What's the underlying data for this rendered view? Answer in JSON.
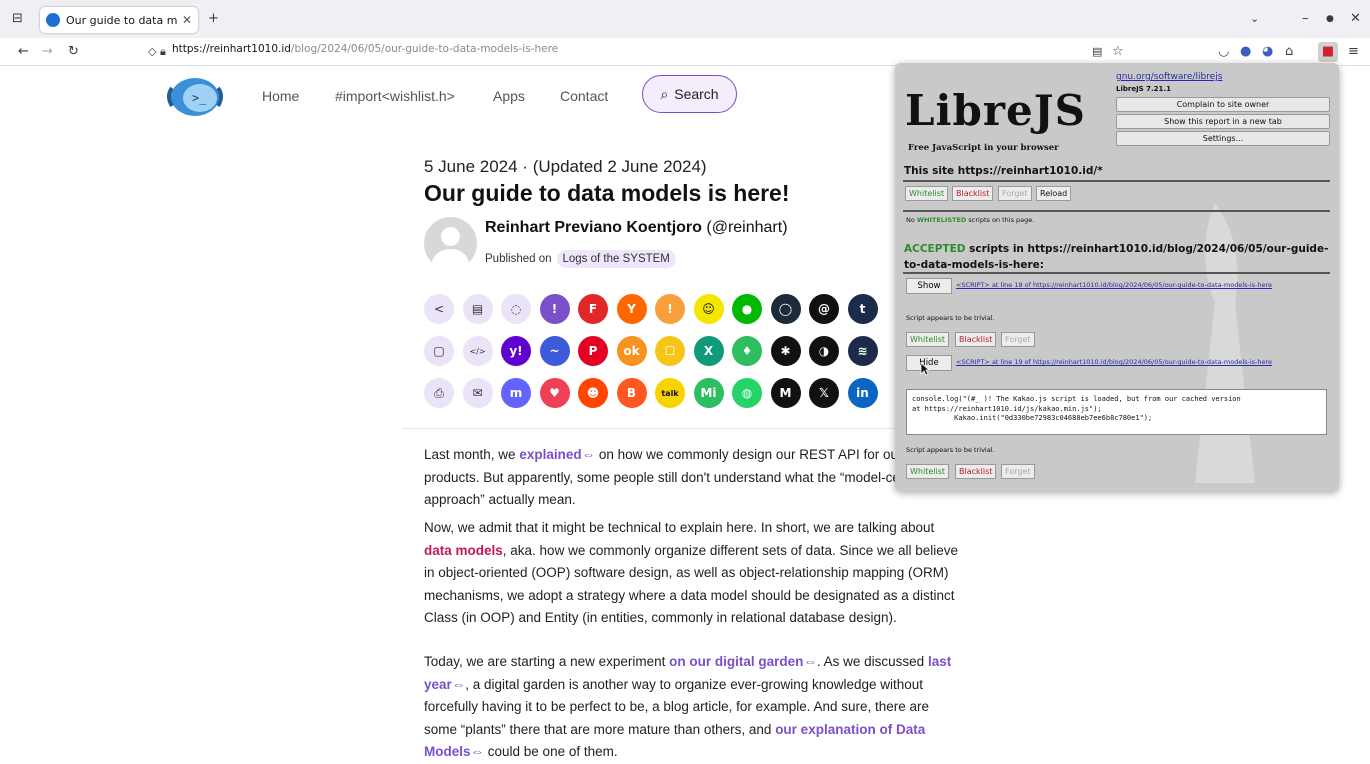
{
  "browser": {
    "tab_title": "Our guide to data models",
    "url_host": "https://reinhart1010.id",
    "url_path": "/blog/2024/06/05/our-guide-to-data-models-is-here"
  },
  "site_nav": {
    "items": [
      "Home",
      "#import<wishlist.h>",
      "Apps",
      "Contact"
    ],
    "search": "Search"
  },
  "article": {
    "date": "5 June 2024 · (Updated 2 June 2024)",
    "title": "Our guide to data models is here!",
    "author_name": "Reinhart Previano Koentjoro",
    "author_handle": "(@reinhart)",
    "published_on": "Published on",
    "category": "Logs of the SYSTEM",
    "p1_a": "Last month, we ",
    "p1_link": "explained",
    "p1_b": " on how we commonly design our REST API for our products. But apparently, some people still don't understand what the “model-centric path approach” actually mean.",
    "p2_a": "Now, we admit that it might be technical to explain here. In short, we are talking about ",
    "p2_link": "data models",
    "p2_b": ", aka. how we commonly organize different sets of data. Since we all believe in object-oriented (OOP) software design, as well as object-relationship mapping (ORM) mechanisms, we adopt a strategy where a data model should be designated as a distinct Class (in OOP) and Entity (in entities, commonly in relational database design).",
    "p3_a": "Today, we are starting a new experiment ",
    "p3_link1": "on our digital garden",
    "p3_b": ". As we discussed ",
    "p3_link2": "last year",
    "p3_c": ", a digital garden is another way to organize ever-growing knowledge without forcefully having it to be perfect to be, a blog article, for example. And sure, there are some “plants” there that are more mature than others, and ",
    "p3_link3": "our explanation of Data Models",
    "p3_d": " could be one of them."
  },
  "share_icons": [
    [
      {
        "name": "share",
        "color": "#ebe3f8",
        "g": "<"
      },
      {
        "name": "print-pdf",
        "color": "#ebe3f8",
        "g": "▤"
      },
      {
        "name": "comment",
        "color": "#ebe3f8",
        "g": "◌"
      },
      {
        "name": "kakao-story",
        "color": "#7b4fc8",
        "g": "!"
      },
      {
        "name": "flipboard",
        "color": "#e12828",
        "g": "F"
      },
      {
        "name": "hacker-news",
        "color": "#ff6600",
        "g": "Y"
      },
      {
        "name": "kakao",
        "color": "#f9a03c",
        "g": "!"
      },
      {
        "name": "snapchat",
        "color": "#f5e600",
        "g": "☺"
      },
      {
        "name": "line",
        "color": "#00b900",
        "g": "●"
      },
      {
        "name": "signal",
        "color": "#1c2a3a",
        "g": "◯"
      },
      {
        "name": "threads",
        "color": "#111111",
        "g": "@"
      },
      {
        "name": "tumblr",
        "color": "#1c2b4a",
        "g": "t"
      }
    ],
    [
      {
        "name": "copy",
        "color": "#ebe3f8",
        "g": "▢"
      },
      {
        "name": "embed",
        "color": "#ebe3f8",
        "g": "</>"
      },
      {
        "name": "yahoo",
        "color": "#5f01d1",
        "g": "y!"
      },
      {
        "name": "messenger",
        "color": "#3b5bdb",
        "g": "~"
      },
      {
        "name": "pinterest",
        "color": "#e60023",
        "g": "P"
      },
      {
        "name": "odnoklassniki",
        "color": "#f7931e",
        "g": "ok"
      },
      {
        "name": "qzone",
        "color": "#f5c518",
        "g": "☐"
      },
      {
        "name": "xing",
        "color": "#0f9b7a",
        "g": "X"
      },
      {
        "name": "evernote",
        "color": "#2dbe60",
        "g": "♦"
      },
      {
        "name": "asterisk",
        "color": "#111111",
        "g": "✱"
      },
      {
        "name": "wechat-mini",
        "color": "#111111",
        "g": "◑"
      },
      {
        "name": "buffer",
        "color": "#1c2b4a",
        "g": "≋"
      }
    ],
    [
      {
        "name": "print",
        "color": "#ebe3f8",
        "g": "⎙"
      },
      {
        "name": "email",
        "color": "#ebe3f8",
        "g": "✉"
      },
      {
        "name": "mastodon",
        "color": "#6364ff",
        "g": "m"
      },
      {
        "name": "pocket",
        "color": "#ef4056",
        "g": "♥"
      },
      {
        "name": "reddit",
        "color": "#ff4500",
        "g": "☻"
      },
      {
        "name": "blogger",
        "color": "#ff5722",
        "g": "B"
      },
      {
        "name": "kakao-talk",
        "color": "#f7d400",
        "g": "talk"
      },
      {
        "name": "mix",
        "color": "#2dbe60",
        "g": "Mi"
      },
      {
        "name": "whatsapp",
        "color": "#25d366",
        "g": "◍"
      },
      {
        "name": "gmail",
        "color": "#111111",
        "g": "M"
      },
      {
        "name": "x",
        "color": "#111111",
        "g": "𝕏"
      },
      {
        "name": "linkedin",
        "color": "#0a66c2",
        "g": "in"
      }
    ]
  ],
  "librejs": {
    "logo": "LibreJS",
    "tagline": "Free JavaScript in your browser",
    "link": "gnu.org/software/librejs",
    "version": "LibreJS 7.21.1",
    "btn_complain": "Complain to site owner",
    "btn_report": "Show this report in a new tab",
    "btn_settings": "Settings...",
    "site_heading": "This site https://reinhart1010.id/*",
    "whitelist": "Whitelist",
    "blacklist": "Blacklist",
    "forget": "Forget",
    "reload": "Reload",
    "no_whitelisted_pre": "No ",
    "no_whitelisted_kw": "WHITELISTED",
    "no_whitelisted_post": " scripts on this page.",
    "accepted_kw": "ACCEPTED",
    "accepted_rest": " scripts in https://reinhart1010.id/blog/2024/06/05/our-guide-to-data-models-is-here:",
    "show": "Show",
    "hide": "Hide",
    "script1": "<SCRIPT> at line 18 of https://reinhart1010.id/blog/2024/06/05/our-guide-to-data-models-is-here",
    "script2": "<SCRIPT> at line 19 of https://reinhart1010.id/blog/2024/06/05/our-guide-to-data-models-is-here",
    "trivial": "Script appears to be trivial.",
    "code": "console.log(\"(#_ )! The Kakao.js script is loaded, but from our cached version\nat https://reinhart1010.id/js/kakao.min.js\");\n          Kakao.init(\"0d330be72983c04688eb7ee6b8c780e1\");"
  }
}
